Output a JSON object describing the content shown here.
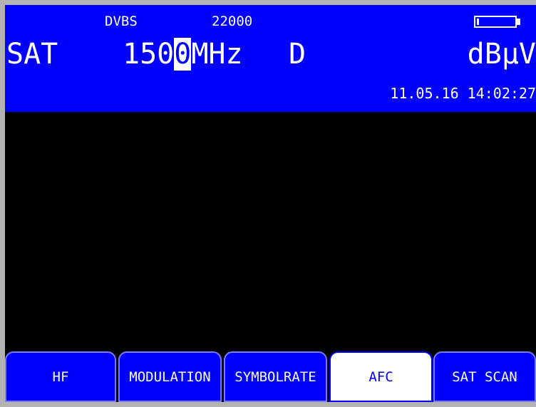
{
  "header": {
    "standard": "DVBS",
    "symbolrate": "22000",
    "band": "SAT",
    "frequency_prefix": "150",
    "frequency_cursor_digit": "0",
    "frequency_unit": "MHz",
    "polarization": "D",
    "level_unit": "dBµV",
    "datetime": "11.05.16 14:02:27",
    "battery_icon": "battery-icon",
    "battery_level": 0.05
  },
  "softkeys": [
    {
      "label": "HF"
    },
    {
      "label": "MODULATION"
    },
    {
      "label": "SYMBOLRATE"
    },
    {
      "label": "AFC",
      "active": true
    },
    {
      "label": "SAT SCAN"
    }
  ],
  "colors": {
    "header_bg": "#0000ff",
    "screen_bg": "#000000",
    "bezel": "#b3b3b3",
    "text": "#ffffff",
    "softkey_border": "#7b7bff"
  }
}
